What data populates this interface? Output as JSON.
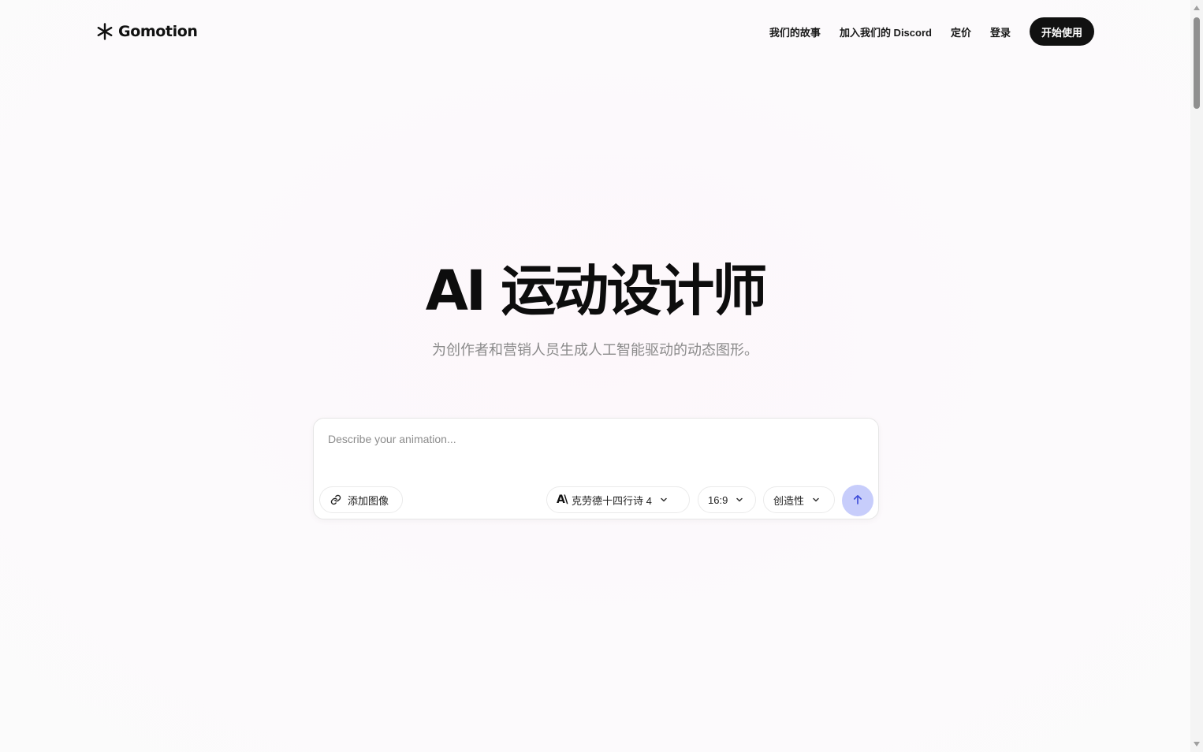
{
  "brand": {
    "name": "Gomotion",
    "icon": "asterisk-icon"
  },
  "nav": {
    "links": [
      "我们的故事",
      "加入我们的 Discord",
      "定价",
      "登录"
    ],
    "cta": "开始使用"
  },
  "hero": {
    "title": "AI 运动设计师",
    "subtitle": "为创作者和营销人员生成人工智能驱动的动态图形。"
  },
  "composer": {
    "placeholder": "Describe your animation...",
    "value": "",
    "add_image": {
      "label": "添加图像",
      "icon": "link-icon"
    },
    "model": {
      "logo": "A\\",
      "label": "克劳德十四行诗 4",
      "icon": "chevron-down-icon"
    },
    "aspect_ratio": {
      "label": "16:9",
      "icon": "chevron-down-icon"
    },
    "style": {
      "label": "创造性",
      "icon": "chevron-down-icon"
    },
    "send": {
      "icon": "arrow-up-icon"
    }
  },
  "colors": {
    "background": "#fcfbfc",
    "text": "#111111",
    "cta_background": "#111111",
    "subtitle": "#8a8a8a",
    "send_button": "#c7cdfb",
    "send_arrow": "#3b4ad8"
  }
}
